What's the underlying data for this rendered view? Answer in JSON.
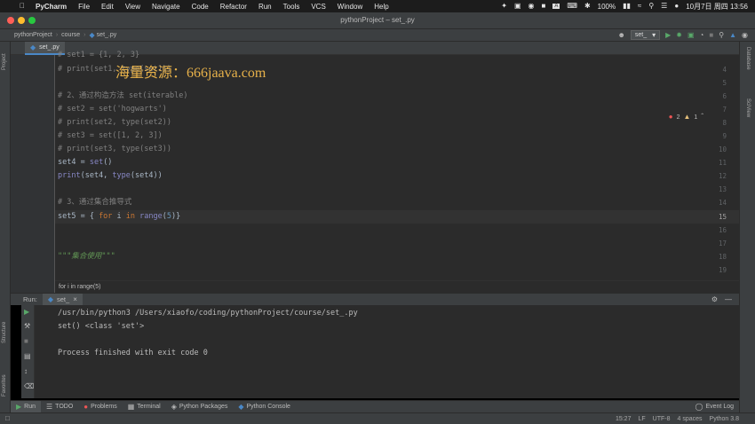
{
  "menubar": {
    "app": "PyCharm",
    "items": [
      "File",
      "Edit",
      "View",
      "Navigate",
      "Code",
      "Refactor",
      "Run",
      "Tools",
      "VCS",
      "Window",
      "Help"
    ],
    "battery": "100%",
    "clock": "10月7日 周四  13:56"
  },
  "window": {
    "title": "pythonProject – set_.py"
  },
  "nav": {
    "project": "pythonProject",
    "folder": "course",
    "file": "set_.py",
    "run_config": "set_"
  },
  "editor": {
    "tab": "set_.py",
    "watermark": "海量资源：666jaava.com",
    "inspections": {
      "errors": "2",
      "warnings": "1"
    },
    "lines": [
      {
        "n": "4",
        "text": "# print(set1, type(set1))"
      },
      {
        "n": "5",
        "text": ""
      },
      {
        "n": "6",
        "text": "# 2、通过构造方法 set(iterable)"
      },
      {
        "n": "7",
        "text": "# set2 = set('hogwarts')"
      },
      {
        "n": "8",
        "text": "# print(set2, type(set2))"
      },
      {
        "n": "9",
        "text": "# set3 = set([1, 2, 3])"
      },
      {
        "n": "10",
        "text": "# print(set3, type(set3))"
      },
      {
        "n": "11",
        "text": "set4 = set()"
      },
      {
        "n": "12",
        "text": "print(set4, type(set4))"
      },
      {
        "n": "13",
        "text": ""
      },
      {
        "n": "14",
        "text": "# 3、通过集合推导式"
      },
      {
        "n": "15",
        "text": "set5 = { for i in range(5)}"
      },
      {
        "n": "16",
        "text": ""
      },
      {
        "n": "17",
        "text": ""
      },
      {
        "n": "18",
        "text": "\"\"\"集合使用\"\"\""
      },
      {
        "n": "19",
        "text": ""
      }
    ],
    "top_partial": "# set1 = {1, 2, 3}",
    "breadcrumb": "for i in range(5)"
  },
  "run": {
    "label": "Run:",
    "tab": "set_",
    "console": [
      "/usr/bin/python3 /Users/xiaofo/coding/pythonProject/course/set_.py",
      "set() <class 'set'>",
      "",
      "Process finished with exit code 0"
    ]
  },
  "side": {
    "left": [
      "Project",
      "Structure",
      "Favorites"
    ],
    "right": [
      "Database",
      "SciView"
    ]
  },
  "bottom_tabs": [
    "Run",
    "TODO",
    "Problems",
    "Terminal",
    "Python Packages",
    "Python Console"
  ],
  "event_log": "Event Log",
  "status": {
    "position": "15:27",
    "line_sep": "LF",
    "encoding": "UTF-8",
    "indent": "4 spaces",
    "interpreter": "Python 3.8"
  }
}
